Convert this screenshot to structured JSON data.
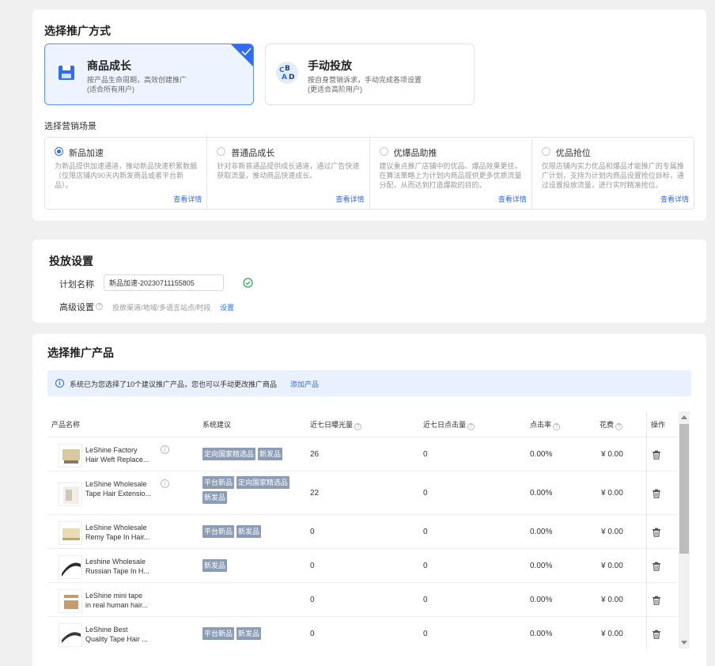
{
  "method_section": {
    "title": "选择推广方式",
    "methods": [
      {
        "title": "商品成长",
        "desc1": "按产品生命周期，高效创建推广",
        "desc2": "(适合所有用户)",
        "selected": true,
        "icon": "save-icon"
      },
      {
        "title": "手动投放",
        "desc1": "按自身营销诉求，手动完成各项设置",
        "desc2": "(更适合高阶用户)",
        "selected": false,
        "icon": "abc-icon"
      }
    ],
    "scene_title": "选择营销场景",
    "scenes": [
      {
        "title": "新品加速",
        "desc": "为新品提供加速通道，推动新品快速积累数据（仅限店铺内90天内新发商品或者平台新品）。",
        "link": "查看详情",
        "selected": true
      },
      {
        "title": "普通品成长",
        "desc": "针对非新普通品提供成长通道，通过广告快速获取流量，推动商品快速成长。",
        "link": "查看详情",
        "selected": false
      },
      {
        "title": "优爆品助推",
        "desc": "建议重点推广店铺中的优品、爆品效果更佳。在算法策略上为计划内商品提供更多优质流量分配，从而达到打造爆款的目的。",
        "link": "查看详情",
        "selected": false
      },
      {
        "title": "优品抢位",
        "desc": "仅限店铺内实力优品和爆品才能推广的专属推广计划，支持为计划内商品设置抢位目标，通过设置投放流量，进行实时精准抢位。",
        "link": "查看详情",
        "selected": false
      }
    ]
  },
  "plan_section": {
    "title": "投放设置",
    "name_label": "计划名称",
    "name_value": "新品加速-20230711155805",
    "advanced_label": "高级设置",
    "advanced_desc": "投放渠道/地域/多语言站点/时段",
    "advanced_link": "设置"
  },
  "product_section": {
    "title": "选择推广产品",
    "banner_text": "系统已为您选择了10个建议推广产品，您也可以手动更改推广商品",
    "banner_link": "添加产品",
    "columns": [
      "产品名称",
      "系统建议",
      "近七日曝光量",
      "近七日点击量",
      "点击率",
      "花费",
      "操作"
    ],
    "rows": [
      {
        "name1": "LeShine Factory",
        "name2": "Hair Weft Replace...",
        "tags": [
          "定向国家精选品",
          "新发品"
        ],
        "impressions": "26",
        "clicks": "0",
        "ctr": "0.00%",
        "cost": "¥ 0.00",
        "info": true
      },
      {
        "name1": "LeShine Wholesale",
        "name2": "Tape Hair Extensio...",
        "tags": [
          "平台新品",
          "定向国家精选品",
          "新发品"
        ],
        "impressions": "22",
        "clicks": "0",
        "ctr": "0.00%",
        "cost": "¥ 0.00",
        "info": true
      },
      {
        "name1": "LeShine Wholesale",
        "name2": "Remy Tape In Hair...",
        "tags": [
          "平台新品",
          "新发品"
        ],
        "impressions": "0",
        "clicks": "0",
        "ctr": "0.00%",
        "cost": "¥ 0.00",
        "info": false
      },
      {
        "name1": "Leshine Wholesale",
        "name2": "Russian Tape In H...",
        "tags": [
          "新发品"
        ],
        "impressions": "0",
        "clicks": "0",
        "ctr": "0.00%",
        "cost": "¥ 0.00",
        "info": false
      },
      {
        "name1": "LeShine mini tape",
        "name2": "in real human hair...",
        "tags": [],
        "impressions": "0",
        "clicks": "0",
        "ctr": "0.00%",
        "cost": "¥ 0.00",
        "info": false
      },
      {
        "name1": "LeShine Best",
        "name2": "Quality Tape Hair ...",
        "tags": [
          "平台新品",
          "新发品"
        ],
        "impressions": "0",
        "clicks": "0",
        "ctr": "0.00%",
        "cost": "¥ 0.00",
        "info": false
      }
    ]
  },
  "colors": {
    "accent": "#2f6bf5",
    "tag": "#8b9db6",
    "success": "#2fa84f"
  }
}
